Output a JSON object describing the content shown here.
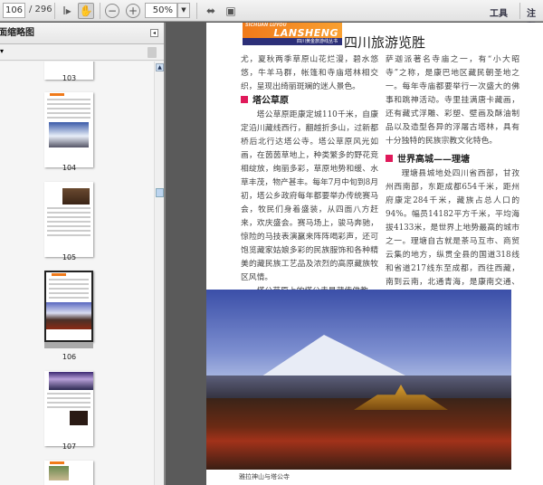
{
  "toolbar": {
    "page_current": "106",
    "page_total": "/ 296",
    "zoom": "50%",
    "menu_tools": "工具",
    "menu_comment": "注释"
  },
  "sidebar": {
    "title": "页面缩略图",
    "thumbnails": [
      {
        "label": "103"
      },
      {
        "label": "104"
      },
      {
        "label": "105"
      },
      {
        "label": "106"
      },
      {
        "label": "107"
      }
    ]
  },
  "page": {
    "banner": {
      "small": "SICHUAN LUYOU",
      "brand": "LANSHENG",
      "series": "四川黄金旅游线丛书"
    },
    "title": "四川旅游览胜",
    "left": {
      "p1": "尤，夏秋两季草原山花烂漫，碧水悠悠，牛羊马群，帐篷和寺庙塔林相交织，呈现出绮丽斑斓的迷人景色。",
      "h1": "塔公草原",
      "p2": "塔公草原距康定城110千米，自康定沿川藏线西行，翻越折多山，过新都桥后北行达塔公寺。塔公草原风光如画，在茵茵草地上，种类繁多的野花竞相绽放，绚丽多彩，草原地势和缓、水草丰茂，物产甚丰。每年7月中旬到8月初，塔公乡政府每年都要举办传统赛马会，牧民们身着盛装，从四面八方赶来，欢庆盛会。赛马场上，骏马奔驰，惊险的马技表演赢来阵阵喝彩声，还可饱览藏家姑娘多彩的民族服饰和各种精美的藏民族工艺品及浓烈的高原藏族牧区风情。",
      "p3": "塔公草原上的塔公寺是藏传佛教"
    },
    "right": {
      "p1": "萨迦派著名寺庙之一，有“小大昭寺”之称，是康巴地区藏民朝圣地之一。每年寺庙都要举行一次盛大的佛事和跳神活动。寺里挂满唐卡藏画，还有藏式浮雕、彩塑、壁画及酥油制品以及造型各异的浮屠古塔林，具有十分独特的民族宗教文化特色。",
      "h1": "世界高城——理塘",
      "p2": "理塘县城地处四川省西部，甘孜州西南部，东距成都654千米，距州府康定284千米，藏族占总人口的94%。幅员14182平方千米，平均海拔4133米，是世界上地势最高的城市之一。理塘自古就是茶马互市、商贸云集的地方，纵贯全县的国道318线和省道217线东至成都，西往西藏，南到云南，北通青海，是康南交通、文化、商贸中心。"
    },
    "caption": "雅拉神山与塔公寺"
  },
  "colors": {
    "accent": "#e0195a",
    "banner_orange": "#f07a1a",
    "banner_blue": "#2c2f78"
  }
}
